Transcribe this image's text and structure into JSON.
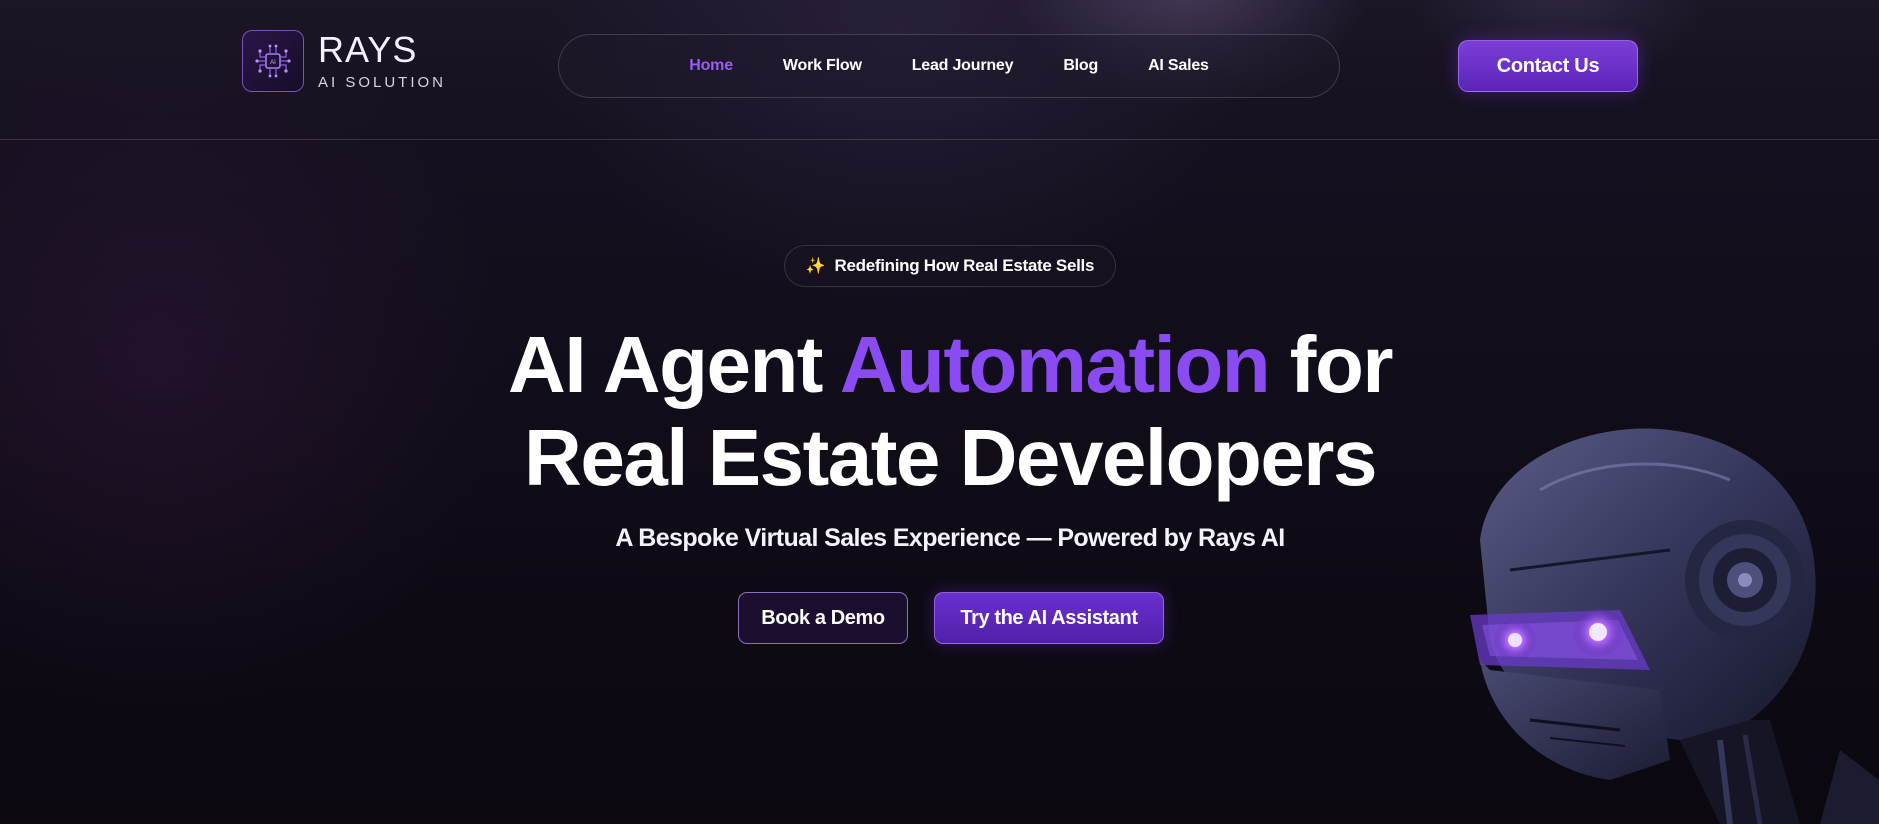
{
  "header": {
    "logo": {
      "title": "RAYS",
      "subtitle": "AI SOLUTION",
      "icon": "circuit-chip-icon"
    },
    "nav": [
      {
        "label": "Home",
        "active": true
      },
      {
        "label": "Work Flow",
        "active": false
      },
      {
        "label": "Lead Journey",
        "active": false
      },
      {
        "label": "Blog",
        "active": false
      },
      {
        "label": "AI Sales",
        "active": false
      }
    ],
    "contact_label": "Contact Us"
  },
  "hero": {
    "badge": {
      "icon": "sparkles-icon",
      "text": "Redefining How Real Estate Sells"
    },
    "headline": {
      "part1": "AI Agent ",
      "accent": "Automation",
      "part2": " for",
      "line2": "Real Estate Developers"
    },
    "subhead": "A Bespoke Virtual Sales Experience — Powered by Rays AI",
    "buttons": {
      "demo": "Book a Demo",
      "assistant": "Try the AI Assistant"
    },
    "illustration": "robot-head-image"
  },
  "colors": {
    "accent": "#8a4cf2",
    "nav_active": "#9a5cf2",
    "background": "#110d18",
    "button_primary": "#5b23b8"
  }
}
